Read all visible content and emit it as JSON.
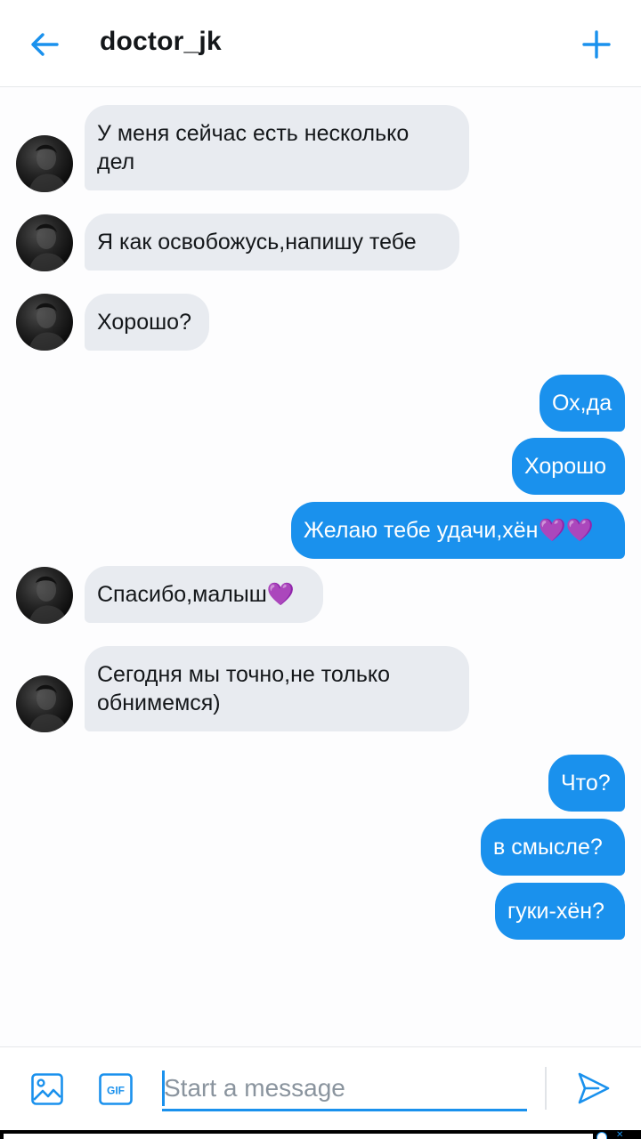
{
  "header": {
    "title": "doctor_jk",
    "back_icon": "arrow-left-icon",
    "new_icon": "plus-icon"
  },
  "messages": [
    {
      "from": "them",
      "lines": [
        "У меня сейчас есть несколько",
        "дел"
      ]
    },
    {
      "from": "them",
      "lines": [
        "Я как освобожусь,напишу тебе"
      ]
    },
    {
      "from": "them",
      "lines": [
        "Хорошо?"
      ]
    },
    {
      "from": "me",
      "lines": [
        "Ох,да"
      ]
    },
    {
      "from": "me",
      "lines": [
        "Хорошо"
      ]
    },
    {
      "from": "me",
      "text": "Желаю тебе удачи,хён",
      "emoji": "💜💜"
    },
    {
      "from": "them",
      "text": "Спасибо,малыш",
      "emoji": "💜"
    },
    {
      "from": "them",
      "lines": [
        "Сегодня мы точно,не только",
        "обнимемся)"
      ]
    },
    {
      "from": "me",
      "lines": [
        "Что?"
      ]
    },
    {
      "from": "me",
      "lines": [
        "в смысле?"
      ]
    },
    {
      "from": "me",
      "lines": [
        "гуки-хён?"
      ]
    }
  ],
  "composer": {
    "placeholder": "Start a message",
    "value": "",
    "image_icon": "image-icon",
    "gif_label": "GIF",
    "send_icon": "send-icon"
  },
  "colors": {
    "accent": "#1a91ed",
    "incoming_bubble": "#e8ebf0",
    "heart": "#b44cf0"
  }
}
